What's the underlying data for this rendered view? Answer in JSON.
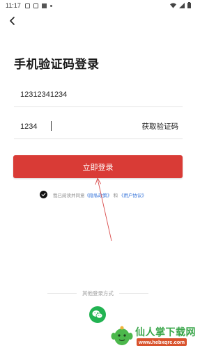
{
  "status_bar": {
    "time": "11:17"
  },
  "page": {
    "title": "手机验证码登录"
  },
  "form": {
    "phone_value": "12312341234",
    "code_value": "1234",
    "get_code_label": "获取验证码",
    "login_label": "立即登录"
  },
  "agreement": {
    "prefix": "我已阅读并同意",
    "privacy_link": "《隐私政策》",
    "and": "和",
    "terms_link": "《用户协议》"
  },
  "other_login": {
    "label": "其他登录方式",
    "methods": [
      "wechat"
    ]
  },
  "watermark": {
    "title": "仙人掌下载网",
    "url": "www.hebxqrc.com"
  },
  "colors": {
    "primary": "#d93b36",
    "link": "#2f6fd8",
    "wechat": "#22b352"
  }
}
